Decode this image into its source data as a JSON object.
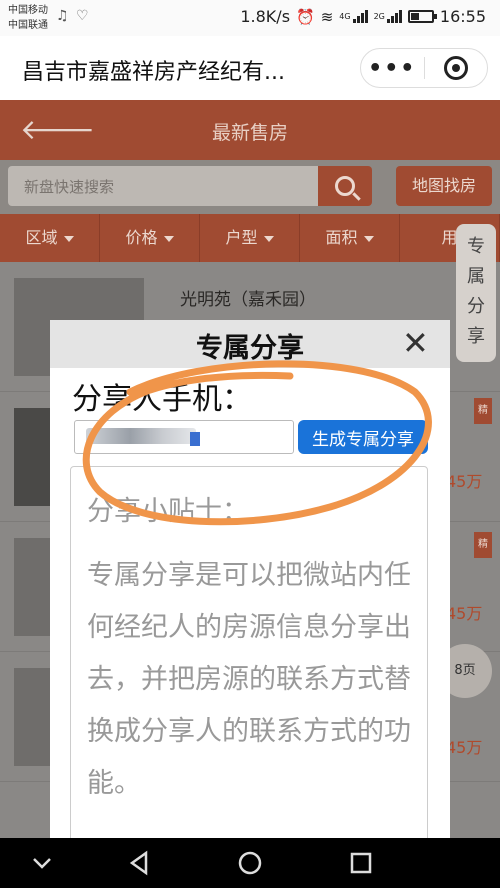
{
  "status_bar": {
    "carrier1": "中国移动",
    "carrier2": "中国联通",
    "speed": "1.8K/s",
    "network1": "4G",
    "network2": "2G",
    "time": "16:55"
  },
  "titlebar": {
    "title": "昌吉市嘉盛祥房产经纪有...",
    "more_glyph": "•••"
  },
  "page": {
    "title": "最新售房",
    "search_placeholder": "新盘快速搜索",
    "map_button": "地图找房",
    "filters": [
      "区域",
      "价格",
      "户型",
      "面积",
      "用"
    ],
    "listing_title": "光明苑（嘉禾园）",
    "prices": [
      "45万",
      "45万",
      "45万"
    ],
    "tag": "精",
    "side_share": "专属分享",
    "page_indicator": "8页"
  },
  "modal": {
    "title": "专属分享",
    "close": "✕",
    "phone_label": "分享人手机：",
    "phone_value": "",
    "generate_button": "生成专属分享",
    "tips_title": "分享小贴士：",
    "tips_body": "专属分享是可以把微站内任何经纪人的房源信息分享出去，并把房源的联系方式替换成分享人的联系方式的功能。"
  },
  "colors": {
    "header_brown": "#a04b32",
    "button_blue": "#1a73d9",
    "annotation_orange": "#f0954a"
  },
  "icons": [
    "back-arrow-icon",
    "search-icon",
    "caret-down-icon",
    "close-icon",
    "more-icon",
    "target-icon",
    "nav-back-icon",
    "nav-home-icon",
    "nav-recent-icon",
    "nav-down-icon"
  ]
}
